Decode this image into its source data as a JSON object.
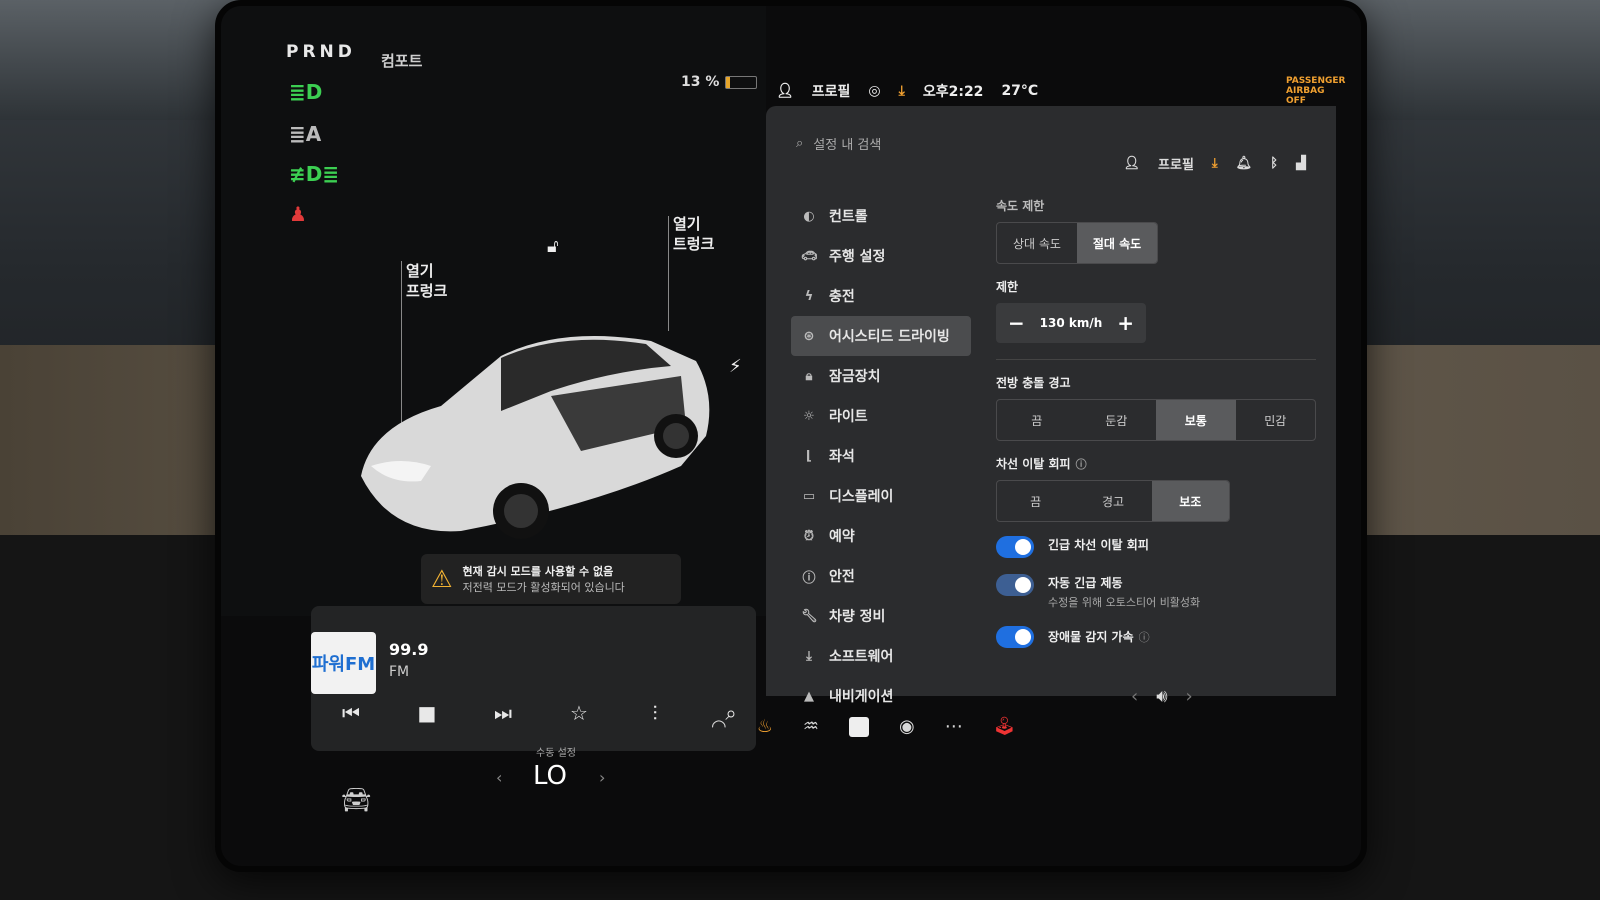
{
  "status": {
    "gear": "PRND",
    "drive_mode": "컴포트",
    "battery_pct": "13 %",
    "battery_level": 0.13,
    "profile": "프로필",
    "time": "오후2:22",
    "temperature": "27°C",
    "airbag": "PASSENGER AIRBAG OFF"
  },
  "car": {
    "frunk_label": "열기\n프렁크",
    "trunk_label": "열기\n트렁크",
    "warning_title": "현재 감시 모드를 사용할 수 없음",
    "warning_sub": "저전력 모드가 활성화되어 있습니다"
  },
  "media": {
    "station_logo": "파워FM",
    "frequency": "99.9",
    "band": "FM"
  },
  "settings": {
    "search_placeholder": "설정 내 검색",
    "profile": "프로필",
    "menu": [
      {
        "label": "컨트롤",
        "icon": "toggle-icon"
      },
      {
        "label": "주행 설정",
        "icon": "car-icon"
      },
      {
        "label": "충전",
        "icon": "bolt-icon"
      },
      {
        "label": "어시스티드 드라이빙",
        "icon": "steering-wheel-icon"
      },
      {
        "label": "잠금장치",
        "icon": "lock-icon"
      },
      {
        "label": "라이트",
        "icon": "sun-icon"
      },
      {
        "label": "좌석",
        "icon": "seat-icon"
      },
      {
        "label": "디스플레이",
        "icon": "display-icon"
      },
      {
        "label": "예약",
        "icon": "alarm-icon"
      },
      {
        "label": "안전",
        "icon": "info-icon"
      },
      {
        "label": "차량 정비",
        "icon": "wrench-icon"
      },
      {
        "label": "소프트웨어",
        "icon": "download-icon"
      },
      {
        "label": "내비게이션",
        "icon": "navigation-icon"
      }
    ],
    "speed_limit_label": "속도 제한",
    "speed_modes": [
      "상대 속도",
      "절대 속도"
    ],
    "speed_mode_selected": "절대 속도",
    "limit_label": "제한",
    "limit_value": "130 km/h",
    "fcw_label": "전방 충돌 경고",
    "fcw_options": [
      "끔",
      "둔감",
      "보통",
      "민감"
    ],
    "fcw_selected": "보통",
    "lane_label": "차선 이탈 회피",
    "lane_options": [
      "끔",
      "경고",
      "보조"
    ],
    "lane_selected": "보조",
    "toggles": [
      {
        "title": "긴급 차선 이탈 회피",
        "sub": "",
        "on": true
      },
      {
        "title": "자동 긴급 제동",
        "sub": "수정을 위해 오토스티어 비활성화",
        "on": true
      },
      {
        "title": "장애물 감지 가속",
        "sub": "",
        "on": true
      }
    ]
  },
  "dock": {
    "climate_label": "수동 설정",
    "climate_value": "LO"
  }
}
